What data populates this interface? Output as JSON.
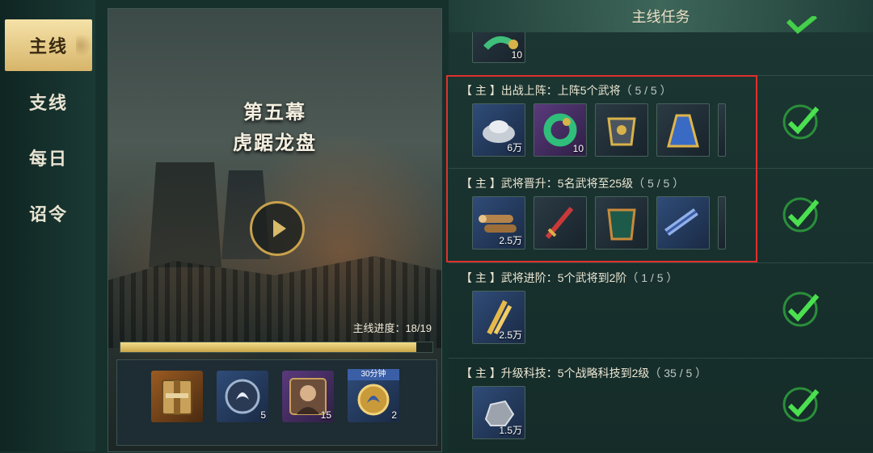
{
  "tabs": [
    "主线",
    "支线",
    "每日",
    "诏令"
  ],
  "scene": {
    "act": "第五幕",
    "name": "虎踞龙盘",
    "progress_label": "主线进度：18/19",
    "progress": 0.947,
    "rewards": [
      {
        "icon": "book-icon",
        "count": ""
      },
      {
        "icon": "speedup-token-icon",
        "count": "5"
      },
      {
        "icon": "hero-puzzle-icon",
        "count": "15"
      },
      {
        "icon": "timed-speedup-icon",
        "count": "2",
        "timer": "30分钟"
      }
    ]
  },
  "tasks_panel": {
    "title": "主线任务",
    "top_partial_count": "10",
    "tasks": [
      {
        "title": "【 主 】出战上阵：上阵5个武将",
        "progress": "（ 5 / 5 ）",
        "rewards": [
          {
            "icon": "silver-ingot-icon",
            "count": "6万"
          },
          {
            "icon": "jade-dragon-icon",
            "count": "10"
          },
          {
            "icon": "armor-icon",
            "count": ""
          },
          {
            "icon": "cloak-icon",
            "count": ""
          }
        ]
      },
      {
        "title": "【 主 】武将晋升：5名武将至25级",
        "progress": "（ 5 / 5 ）",
        "rewards": [
          {
            "icon": "wood-logs-icon",
            "count": "2.5万"
          },
          {
            "icon": "sword-icon",
            "count": ""
          },
          {
            "icon": "armor-icon",
            "count": ""
          },
          {
            "icon": "scroll-icon",
            "count": ""
          }
        ]
      },
      {
        "title": "【 主 】武将进阶：5个武将到2阶",
        "progress": "（ 1 / 5 ）",
        "rewards": [
          {
            "icon": "wheat-icon",
            "count": "2.5万"
          }
        ]
      },
      {
        "title": "【 主 】升级科技：5个战略科技到2级",
        "progress": "（ 35 / 5 ）",
        "rewards": [
          {
            "icon": "stone-icon",
            "count": "1.5万"
          }
        ]
      }
    ]
  }
}
